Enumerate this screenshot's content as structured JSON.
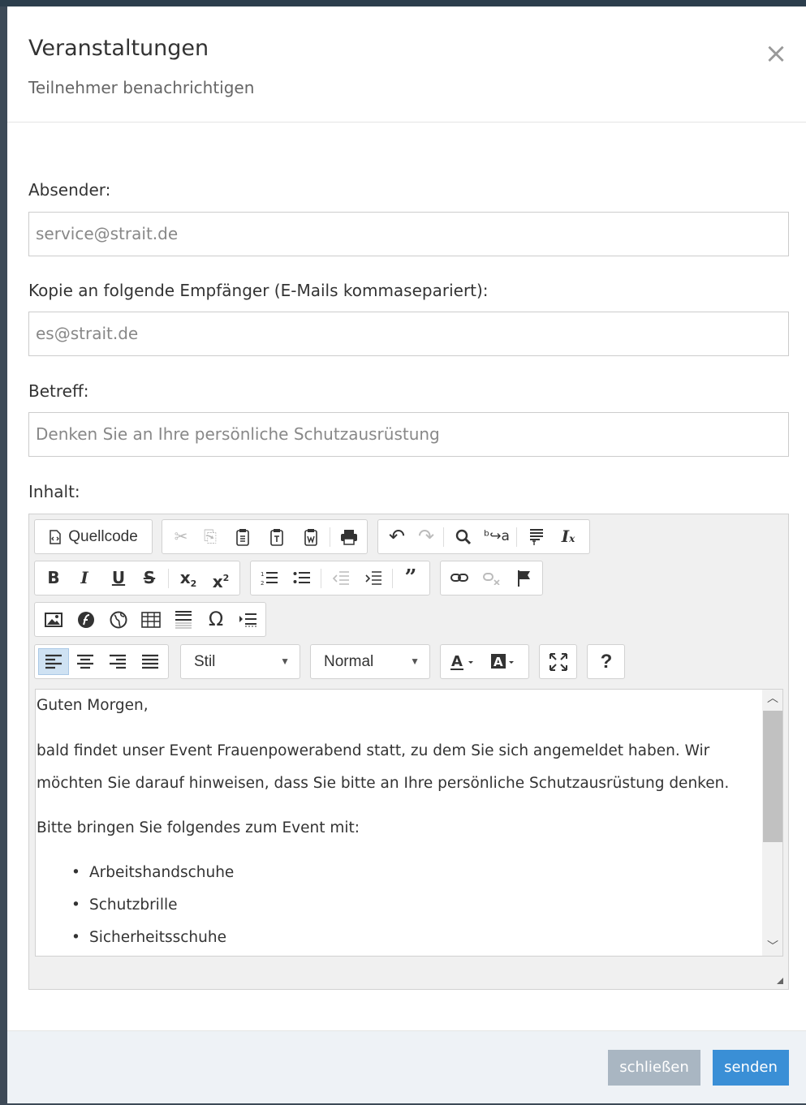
{
  "modal": {
    "title": "Veranstaltungen",
    "subtitle": "Teilnehmer benachrichtigen",
    "close_icon": "×"
  },
  "form": {
    "sender_label": "Absender:",
    "sender_value": "service@strait.de",
    "cc_label": "Kopie an folgende Empfänger (E-Mails kommasepariert):",
    "cc_value": "es@strait.de",
    "subject_label": "Betreff:",
    "subject_value": "Denken Sie an Ihre persönliche Schutzausrüstung",
    "content_label": "Inhalt:"
  },
  "editor": {
    "source_label": "Quellcode",
    "style_combo": "Stil",
    "format_combo": "Normal",
    "help_label": "?",
    "content": {
      "greeting": "Guten Morgen,",
      "paragraph1_line1": "bald findet unser Event Frauenpowerabend statt, zu dem Sie sich angemeldet haben. Wir",
      "paragraph1_line2": "möchten Sie darauf hinweisen, dass Sie bitte an Ihre persönliche Schutzausrüstung denken.",
      "paragraph2": "Bitte bringen Sie folgendes zum Event mit:",
      "list": [
        "Arbeitshandschuhe",
        "Schutzbrille",
        "Sicherheitsschuhe"
      ]
    }
  },
  "footer": {
    "close_label": "schließen",
    "send_label": "senden"
  },
  "colors": {
    "primary": "#3a8fd6",
    "secondary": "#a9b6c2",
    "active_align": "#cfe2f3"
  }
}
